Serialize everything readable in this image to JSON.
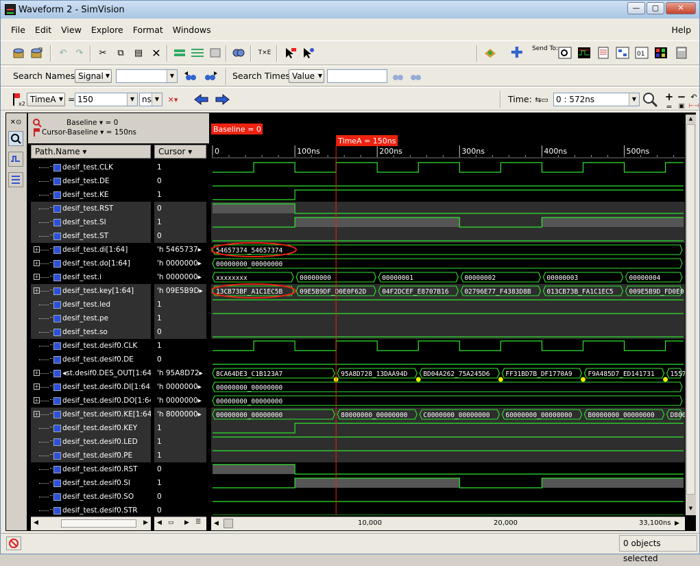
{
  "window": {
    "title": "Waveform 2 - SimVision"
  },
  "menu": {
    "items": [
      "File",
      "Edit",
      "View",
      "Explore",
      "Format",
      "Windows"
    ],
    "help": "Help"
  },
  "toolbar": {
    "send_to": "Send To:"
  },
  "search": {
    "names_label": "Search Names:",
    "names_mode": "Signal",
    "names_value": "",
    "times_label": "Search Times:",
    "times_mode": "Value",
    "times_value": ""
  },
  "cursorbar": {
    "cursor": "TimeA",
    "eq": "=",
    "value": "150",
    "unit": "ns",
    "time_label": "Time:",
    "time_range": "0 : 572ns"
  },
  "baselines": {
    "baseline": "Baseline ▾ = 0",
    "cursor_baseline": "Cursor-Baseline ▾ = 150ns"
  },
  "columns": {
    "name": "Path.Name ▾",
    "cursor": "Cursor ▾"
  },
  "markers": {
    "baseline": "Baseline = 0",
    "timeA": "TimeA = 150ns"
  },
  "timescale": {
    "ticks": [
      "0",
      "100ns",
      "200ns",
      "300ns",
      "400ns",
      "500ns"
    ]
  },
  "hscroll": {
    "labels": [
      "10,000",
      "20,000",
      "33,100ns"
    ]
  },
  "status": {
    "text": "0 objects selected"
  },
  "signals": [
    {
      "name": "desif_test.CLK",
      "cursor": "1",
      "expand": false
    },
    {
      "name": "desif_test.DE",
      "cursor": "0",
      "expand": false
    },
    {
      "name": "desif_test.KE",
      "cursor": "1",
      "expand": false
    },
    {
      "name": "desif_test.RST",
      "cursor": "0",
      "expand": false
    },
    {
      "name": "desif_test.SI",
      "cursor": "1",
      "expand": false
    },
    {
      "name": "desif_test.ST",
      "cursor": "0",
      "expand": false
    },
    {
      "name": "desif_test.di[1:64]",
      "cursor": "'h 5465737▸",
      "expand": true
    },
    {
      "name": "desif_test.do[1:64]",
      "cursor": "'h 0000000▸",
      "expand": true
    },
    {
      "name": "desif_test.i",
      "cursor": "'h 0000000▸",
      "expand": true
    },
    {
      "name": "desif_test.key[1:64]",
      "cursor": "'h 09E5B9D▸",
      "expand": true
    },
    {
      "name": "desif_test.led",
      "cursor": "1",
      "expand": false
    },
    {
      "name": "desif_test.pe",
      "cursor": "1",
      "expand": false
    },
    {
      "name": "desif_test.so",
      "cursor": "0",
      "expand": false
    },
    {
      "name": "desif_test.desif0.CLK",
      "cursor": "1",
      "expand": false
    },
    {
      "name": "desif_test.desif0.DE",
      "cursor": "0",
      "expand": false
    },
    {
      "name": "◂st.desif0.DES_OUT[1:64]",
      "cursor": "'h 95A8D72▸",
      "expand": true
    },
    {
      "name": "desif_test.desif0.DI[1:64]",
      "cursor": "'h 0000000▸",
      "expand": true
    },
    {
      "name": "desif_test.desif0.DO[1:64]",
      "cursor": "'h 0000000▸",
      "expand": true
    },
    {
      "name": "desif_test.desif0.KE[1:64]",
      "cursor": "'h 8000000▸",
      "expand": true
    },
    {
      "name": "desif_test.desif0.KEY",
      "cursor": "1",
      "expand": false
    },
    {
      "name": "desif_test.desif0.LED",
      "cursor": "1",
      "expand": false
    },
    {
      "name": "desif_test.desif0.PE",
      "cursor": "1",
      "expand": false
    },
    {
      "name": "desif_test.desif0.RST",
      "cursor": "0",
      "expand": false
    },
    {
      "name": "desif_test.desif0.SI",
      "cursor": "1",
      "expand": false
    },
    {
      "name": "desif_test.desif0.SO",
      "cursor": "0",
      "expand": false
    },
    {
      "name": "desif_test.desif0.STR",
      "cursor": "0",
      "expand": false
    }
  ],
  "waves": {
    "time_range_ns": [
      0,
      572
    ],
    "digital": [
      {
        "row": 0,
        "edges_ns": [
          0,
          50,
          100,
          150,
          200,
          250,
          300,
          350,
          400,
          450,
          500,
          550
        ],
        "start": 0
      },
      {
        "row": 1,
        "edges_ns": [],
        "start": 0
      },
      {
        "row": 2,
        "edges_ns": [
          100
        ],
        "start": 0
      },
      {
        "row": 3,
        "edges_ns": [
          100
        ],
        "start": 1,
        "fill_high": true
      },
      {
        "row": 4,
        "edges_ns": [
          100,
          300,
          400
        ],
        "start": 0,
        "fill_high": true
      },
      {
        "row": 5,
        "edges_ns": [],
        "start": 0
      },
      {
        "row": 10,
        "edges_ns": [],
        "start": 1
      },
      {
        "row": 11,
        "edges_ns": [],
        "start": 1
      },
      {
        "row": 12,
        "edges_ns": [],
        "start": 0
      },
      {
        "row": 13,
        "edges_ns": [
          0,
          50,
          100,
          150,
          200,
          250,
          300,
          350,
          400,
          450,
          500,
          550
        ],
        "start": 0
      },
      {
        "row": 14,
        "edges_ns": [],
        "start": 0
      },
      {
        "row": 19,
        "edges_ns": [
          100
        ],
        "start": 0
      },
      {
        "row": 20,
        "edges_ns": [],
        "start": 1
      },
      {
        "row": 21,
        "edges_ns": [],
        "start": 1
      },
      {
        "row": 22,
        "edges_ns": [
          100
        ],
        "start": 1,
        "fill_high": true
      },
      {
        "row": 23,
        "edges_ns": [
          100,
          300,
          400
        ],
        "start": 0,
        "fill_high": true
      },
      {
        "row": 24,
        "edges_ns": [],
        "start": 0
      },
      {
        "row": 25,
        "edges_ns": [],
        "start": 0
      }
    ],
    "bus": [
      {
        "row": 6,
        "segments": [
          {
            "t0": 0,
            "t1": 572,
            "v": "54657374_54657374",
            "circled": true
          }
        ]
      },
      {
        "row": 7,
        "segments": [
          {
            "t0": 0,
            "t1": 572,
            "v": "00000000_00000000"
          }
        ]
      },
      {
        "row": 8,
        "segments": [
          {
            "t0": 0,
            "t1": 100,
            "v": "xxxxxxxx"
          },
          {
            "t0": 100,
            "t1": 200,
            "v": "00000000"
          },
          {
            "t0": 200,
            "t1": 300,
            "v": "00000001"
          },
          {
            "t0": 300,
            "t1": 400,
            "v": "00000002"
          },
          {
            "t0": 400,
            "t1": 500,
            "v": "00000003"
          },
          {
            "t0": 500,
            "t1": 572,
            "v": "00000004"
          }
        ]
      },
      {
        "row": 9,
        "segments": [
          {
            "t0": 0,
            "t1": 100,
            "v": "13CB73BF_A1C1EC5B",
            "circled": true
          },
          {
            "t0": 100,
            "t1": 200,
            "v": "09E5B9DF_D0E0F62D"
          },
          {
            "t0": 200,
            "t1": 300,
            "v": "04F2DCEF_E8707B16"
          },
          {
            "t0": 300,
            "t1": 400,
            "v": "02796E77_F4383D8B"
          },
          {
            "t0": 400,
            "t1": 500,
            "v": "013CB73B_FA1C1EC5"
          },
          {
            "t0": 500,
            "t1": 572,
            "v": "009E5B9D_FD0E0"
          }
        ]
      },
      {
        "row": 15,
        "markers": true,
        "segments": [
          {
            "t0": 0,
            "t1": 150,
            "v": "8CA64DE3_C1B123A7"
          },
          {
            "t0": 150,
            "t1": 250,
            "v": "95A8D728_13DAA94D"
          },
          {
            "t0": 250,
            "t1": 350,
            "v": "BD04A262_75A245D6"
          },
          {
            "t0": 350,
            "t1": 450,
            "v": "FF31BD7B_DF1770A9"
          },
          {
            "t0": 450,
            "t1": 550,
            "v": "F9A485D7_ED141731"
          },
          {
            "t0": 550,
            "t1": 572,
            "v": "1557"
          }
        ]
      },
      {
        "row": 16,
        "segments": [
          {
            "t0": 0,
            "t1": 572,
            "v": "00000000_00000000"
          }
        ]
      },
      {
        "row": 17,
        "segments": [
          {
            "t0": 0,
            "t1": 572,
            "v": "00000000_00000000"
          }
        ]
      },
      {
        "row": 18,
        "segments": [
          {
            "t0": 0,
            "t1": 150,
            "v": "00000000_00000000"
          },
          {
            "t0": 150,
            "t1": 250,
            "v": "80000000_00000000"
          },
          {
            "t0": 250,
            "t1": 350,
            "v": "C0000000_00000000"
          },
          {
            "t0": 350,
            "t1": 450,
            "v": "60000000_00000000"
          },
          {
            "t0": 450,
            "t1": 550,
            "v": "B0000000_00000000"
          },
          {
            "t0": 550,
            "t1": 572,
            "v": "D800"
          }
        ]
      }
    ]
  }
}
